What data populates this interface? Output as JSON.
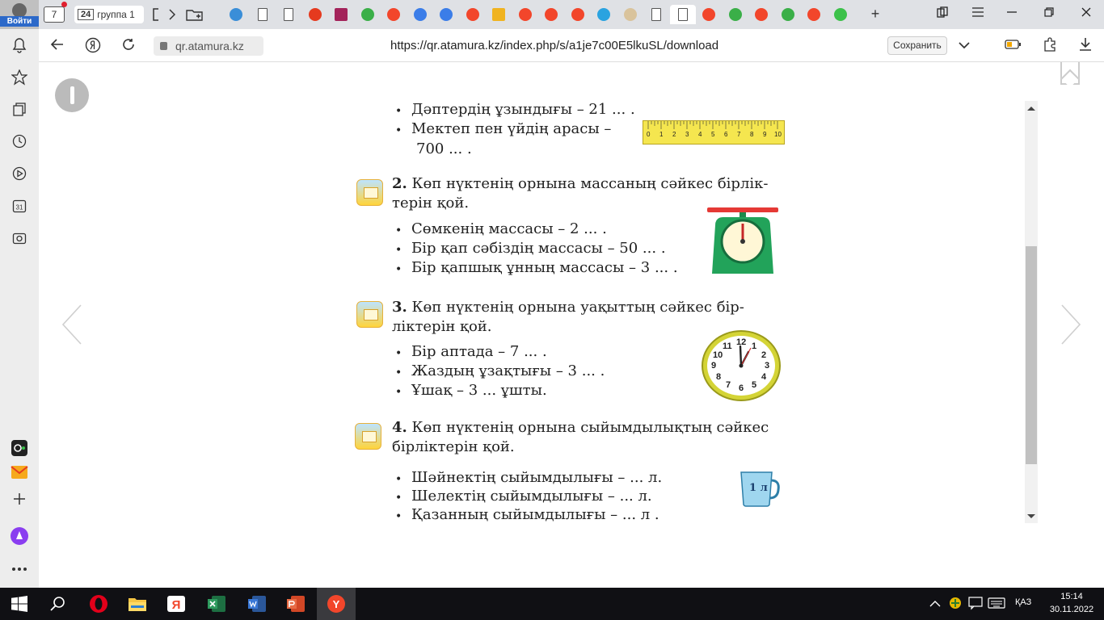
{
  "tabbar": {
    "login_label": "Войти",
    "tab_count": "7",
    "group_number": "24",
    "group_label": "группа 1"
  },
  "addressbar": {
    "domain": "qr.atamura.kz",
    "url": "https://qr.atamura.kz/index.php/s/a1je7c00E5lkuSL/download",
    "save_label": "Сохранить"
  },
  "document": {
    "length_items": [
      "Дәптердің ұзындығы – 21 ... .",
      "Мектеп пен үйдің арасы –",
      "700 ... ."
    ],
    "ruler_ticks": [
      "0",
      "1",
      "2",
      "3",
      "4",
      "5",
      "6",
      "7",
      "8",
      "9",
      "10"
    ],
    "task2": {
      "number": "2.",
      "title_1": "Көп нүктенің орнына массаның сәйкес бірлік-",
      "title_2": "терін қой.",
      "items": [
        "Сөмкенің массасы – 2 ... .",
        "Бір қап сәбіздің массасы – 50 ... .",
        "Бір қапшық ұнның массасы – 3 ... ."
      ]
    },
    "task3": {
      "number": "3.",
      "title_1": "Көп нүктенің орнына уақыттың сәйкес бір-",
      "title_2": "ліктерін қой.",
      "items": [
        "Бір аптада – 7 ... .",
        "Жаздың ұзақтығы – 3 ... .",
        "Ұшақ – 3 ... ұшты."
      ]
    },
    "clock_numbers": [
      "12",
      "1",
      "2",
      "3",
      "4",
      "5",
      "6",
      "7",
      "8",
      "9",
      "10",
      "11"
    ],
    "task4": {
      "number": "4.",
      "title_1": "Көп нүктенің орнына сыйымдылықтың сәйкес",
      "title_2": "бірліктерін қой.",
      "items": [
        "Шәйнектің сыйымдылығы – ... л.",
        "Шелектің сыйымдылығы – ... л.",
        "Қазанның сыйымдылығы – ... л ."
      ]
    },
    "jug_label": "1 л"
  },
  "taskbar": {
    "language": "ҚАЗ",
    "time": "15:14",
    "date": "30.11.2022"
  },
  "colors": {
    "accent": "#2c69c9",
    "ruler": "#f5e64f",
    "scale_body": "#22a35a",
    "scale_top": "#e53935",
    "clock_rim": "#d4d436",
    "jug": "#9fd6ef"
  }
}
